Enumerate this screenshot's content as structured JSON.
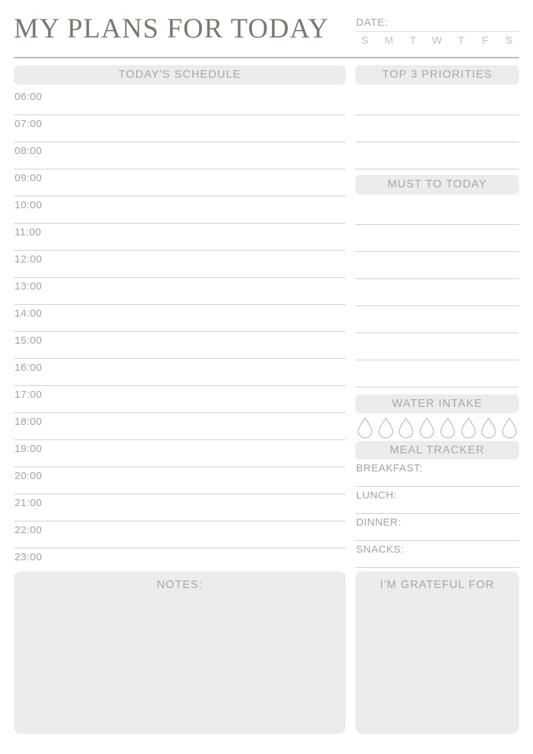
{
  "header": {
    "title": "MY PLANS FOR TODAY",
    "date_label": "DATE:",
    "weekdays": [
      "S",
      "M",
      "T",
      "W",
      "T",
      "F",
      "S"
    ]
  },
  "schedule": {
    "heading": "TODAY'S SCHEDULE",
    "times": [
      "06:00",
      "07:00",
      "08:00",
      "09:00",
      "10:00",
      "11:00",
      "12:00",
      "13:00",
      "14:00",
      "15:00",
      "16:00",
      "17:00",
      "18:00",
      "19:00",
      "20:00",
      "21:00",
      "22:00",
      "23:00"
    ]
  },
  "priorities": {
    "heading": "TOP 3 PRIORITIES",
    "line_count": 3
  },
  "musts": {
    "heading": "MUST TO TODAY",
    "line_count": 7
  },
  "water": {
    "heading": "WATER INTAKE",
    "drop_count": 8
  },
  "meals": {
    "heading": "MEAL TRACKER",
    "rows": [
      "BREAKFAST:",
      "LUNCH:",
      "DINNER:",
      "SNACKS:"
    ]
  },
  "notes": {
    "heading": "NOTES:"
  },
  "grateful": {
    "heading": "I'M GRATEFUL FOR"
  },
  "colors": {
    "title_text": "#7c7870",
    "muted_text": "#a5a29d",
    "pill_fill": "#ececeb",
    "rule": "#cfcdc9",
    "header_rule": "#b9b6b1",
    "page_bg": "#ffffff"
  }
}
